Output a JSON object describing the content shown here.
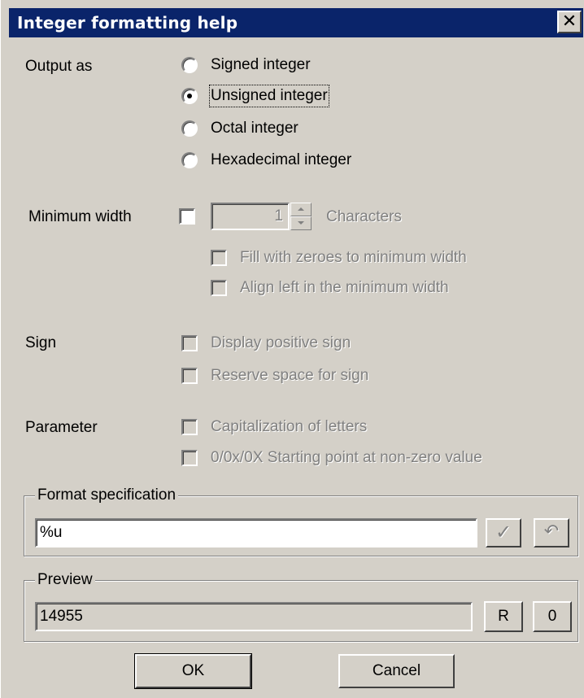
{
  "dialog": {
    "title": "Integer formatting help",
    "close_glyph": "✕"
  },
  "output_as": {
    "label": "Output as",
    "options": [
      {
        "label": "Signed integer",
        "checked": false
      },
      {
        "label": "Unsigned integer",
        "checked": true
      },
      {
        "label": "Octal integer",
        "checked": false
      },
      {
        "label": "Hexadecimal integer",
        "checked": false
      }
    ]
  },
  "minimum_width": {
    "label": "Minimum width",
    "checked": false,
    "value": "1",
    "unit_label": "Characters",
    "fill_zeroes_label": "Fill with zeroes to minimum width",
    "align_left_label": "Align left in the minimum width"
  },
  "sign": {
    "label": "Sign",
    "display_positive_label": "Display positive sign",
    "reserve_space_label": "Reserve space for sign"
  },
  "parameter": {
    "label": "Parameter",
    "capitalization_label": "Capitalization of letters",
    "starting_point_label": "0/0x/0X Starting point at non-zero value"
  },
  "format_spec": {
    "group_label": "Format specification",
    "value": "%u",
    "apply_glyph": "✓",
    "undo_glyph": "↶"
  },
  "preview": {
    "group_label": "Preview",
    "value": "14955",
    "r_label": "R",
    "zero_label": "0"
  },
  "buttons": {
    "ok_label": "OK",
    "cancel_label": "Cancel"
  }
}
